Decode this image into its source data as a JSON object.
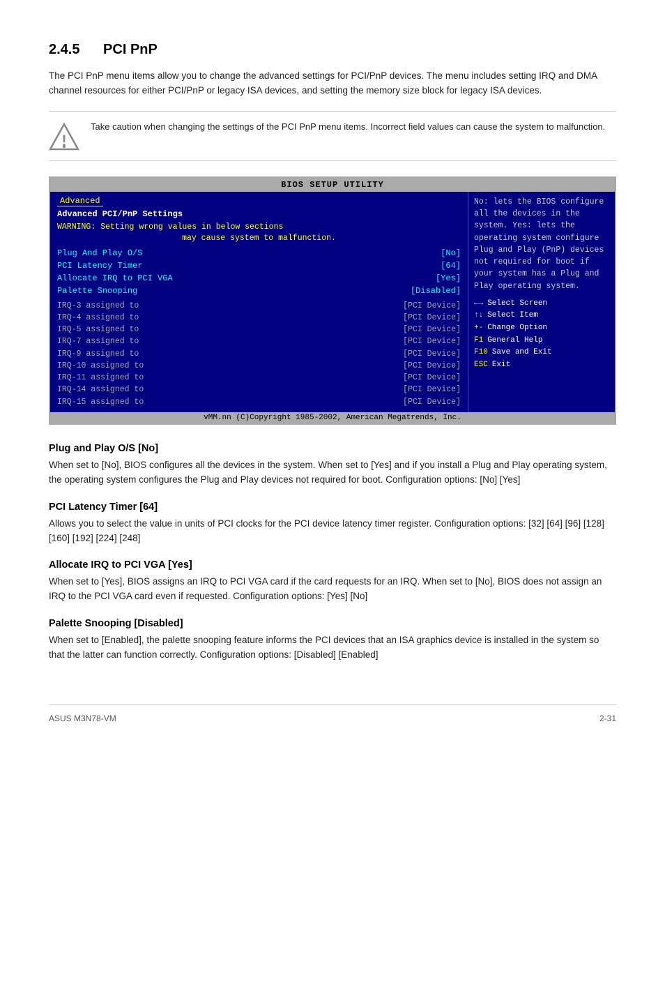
{
  "page": {
    "section_number": "2.4.5",
    "section_title": "PCI PnP",
    "intro_text": "The PCI PnP menu items allow you to change the advanced settings for PCI/PnP devices. The menu includes setting IRQ and DMA channel resources for either PCI/PnP or legacy ISA devices, and setting the memory size block for legacy ISA devices.",
    "warning_text": "Take caution when changing the settings of the PCI PnP menu items. Incorrect field values can cause the system to malfunction.",
    "bios": {
      "title": "BIOS SETUP UTILITY",
      "tab": "Advanced",
      "section_title": "Advanced PCI/PnP Settings",
      "warning_line1": "WARNING: Setting wrong values in below sections",
      "warning_line2": "may cause system to malfunction.",
      "settings": [
        {
          "label": "Plug And Play O/S",
          "value": "[No]"
        },
        {
          "label": "PCI Latency Timer",
          "value": "[64]"
        },
        {
          "label": "Allocate IRQ to PCI VGA",
          "value": "[Yes]"
        },
        {
          "label": "Palette Snooping",
          "value": "[Disabled]"
        }
      ],
      "irq_rows": [
        {
          "label": "IRQ-3  assigned to",
          "value": "[PCI Device]"
        },
        {
          "label": "IRQ-4  assigned to",
          "value": "[PCI Device]"
        },
        {
          "label": "IRQ-5  assigned to",
          "value": "[PCI Device]"
        },
        {
          "label": "IRQ-7  assigned to",
          "value": "[PCI Device]"
        },
        {
          "label": "IRQ-9  assigned to",
          "value": "[PCI Device]"
        },
        {
          "label": "IRQ-10 assigned to",
          "value": "[PCI Device]"
        },
        {
          "label": "IRQ-11 assigned to",
          "value": "[PCI Device]"
        },
        {
          "label": "IRQ-14 assigned to",
          "value": "[PCI Device]"
        },
        {
          "label": "IRQ-15 assigned to",
          "value": "[PCI Device]"
        }
      ],
      "right_text": "No: lets the BIOS configure all the devices in the system. Yes: lets the operating system configure Plug and Play (PnP) devices not required for boot if your system has a Plug and Play operating system.",
      "keys": [
        {
          "key": "←→",
          "desc": "Select Screen"
        },
        {
          "key": "↑↓",
          "desc": "Select Item"
        },
        {
          "key": "+-",
          "desc": "Change Option"
        },
        {
          "key": "F1",
          "desc": "General Help"
        },
        {
          "key": "F10",
          "desc": "Save and Exit"
        },
        {
          "key": "ESC",
          "desc": "Exit"
        }
      ],
      "footer": "vMM.nn (C)Copyright 1985-2002, American Megatrends, Inc."
    },
    "subsections": [
      {
        "id": "plug-play",
        "heading": "Plug and Play O/S [No]",
        "text": "When set to [No], BIOS configures all the devices in the system. When set to [Yes] and if you install a Plug and Play operating system, the operating system configures the Plug and Play devices not required for boot.\nConfiguration options: [No] [Yes]"
      },
      {
        "id": "pci-latency",
        "heading": "PCI Latency Timer [64]",
        "text": "Allows you to select the value in units of PCI clocks for the PCI device latency timer register. Configuration options: [32] [64] [96] [128] [160] [192] [224] [248]"
      },
      {
        "id": "allocate-irq",
        "heading": "Allocate IRQ to PCI VGA [Yes]",
        "text": "When set to [Yes], BIOS assigns an IRQ to PCI VGA card if the card requests for an IRQ. When set to [No], BIOS does not assign an IRQ to the PCI VGA card even if requested. Configuration options: [Yes] [No]"
      },
      {
        "id": "palette-snooping",
        "heading": "Palette Snooping [Disabled]",
        "text": "When set to [Enabled], the palette snooping feature informs the PCI devices that an ISA graphics device is installed in the system so that the latter can function correctly. Configuration options: [Disabled] [Enabled]"
      }
    ],
    "footer": {
      "left": "ASUS M3N78-VM",
      "right": "2-31"
    }
  }
}
